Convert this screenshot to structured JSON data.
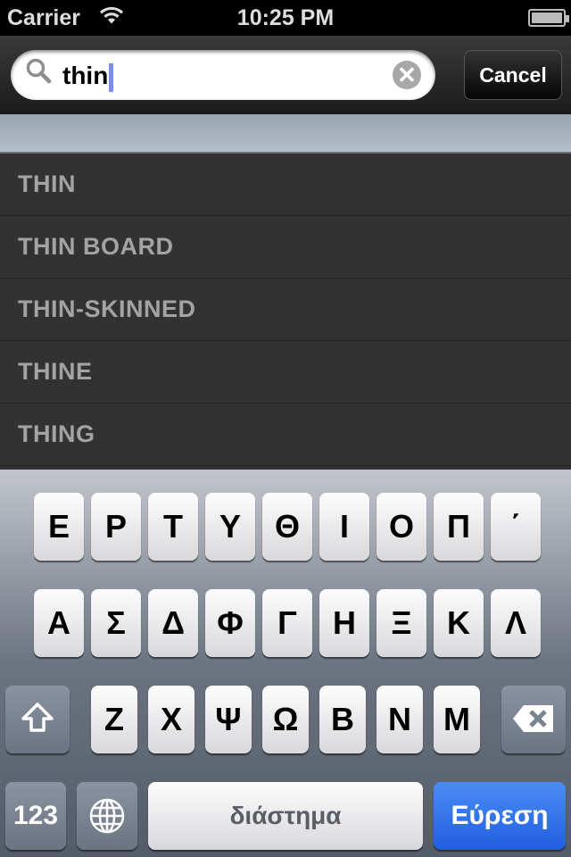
{
  "status": {
    "carrier": "Carrier",
    "time": "10:25 PM",
    "wifi_icon": "wifi-icon",
    "battery_level": 1.0
  },
  "search": {
    "value": "thin",
    "cancel": "Cancel"
  },
  "results": [
    "THIN",
    "THIN BOARD",
    "THIN-SKINNED",
    "THINE",
    "THING"
  ],
  "keyboard": {
    "row1": [
      "Ε",
      "Ρ",
      "Τ",
      "Υ",
      "Θ",
      "Ι",
      "Ο",
      "Π",
      "΄"
    ],
    "row2": [
      "Α",
      "Σ",
      "Δ",
      "Φ",
      "Γ",
      "Η",
      "Ξ",
      "Κ",
      "Λ"
    ],
    "row3": [
      "Ζ",
      "Χ",
      "Ψ",
      "Ω",
      "Β",
      "Ν",
      "Μ"
    ],
    "numbers": "123",
    "space": "διάστημα",
    "search": "Εύρεση",
    "search_color": "#2a6be8"
  }
}
